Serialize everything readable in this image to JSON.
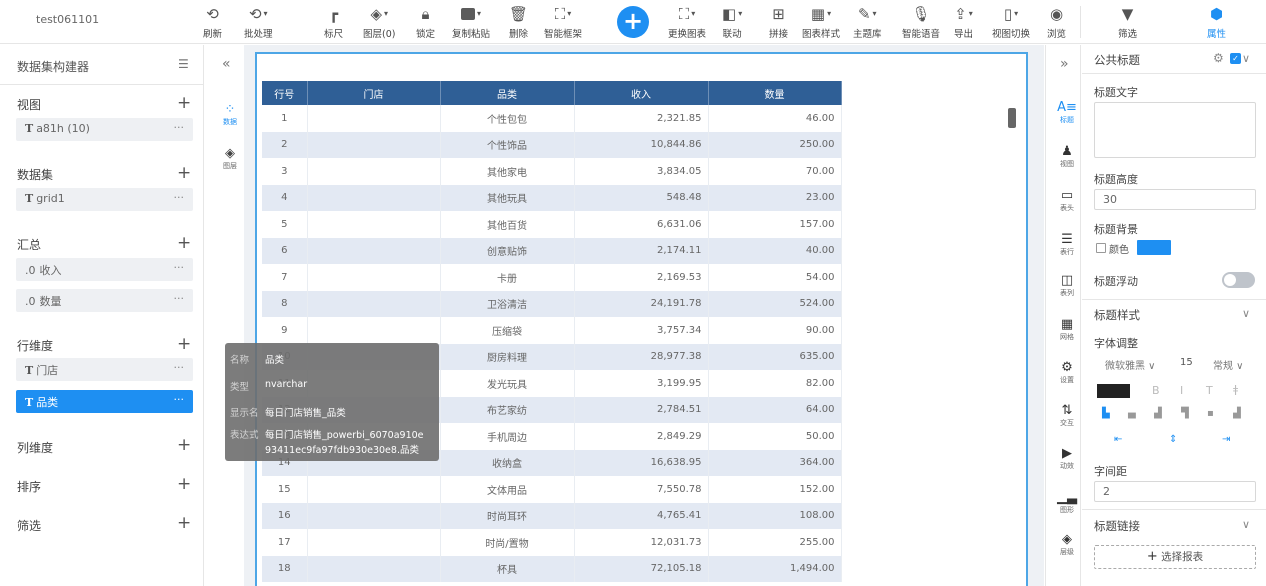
{
  "app": {
    "title": "test061101"
  },
  "toolbar": {
    "refresh": "刷新",
    "batch": "批处理",
    "ruler": "标尺",
    "layers": "图层(0)",
    "lock": "锁定",
    "copy_paste": "复制粘贴",
    "delete": "删除",
    "smart_frame": "智能框架",
    "add": "+",
    "replace_chart": "更换图表",
    "linkage": "联动",
    "stitch": "拼接",
    "chart_style": "图表样式",
    "theme_lib": "主题库",
    "smart_voice": "智能语音",
    "export": "导出",
    "view_switch": "视图切换",
    "browse": "浏览",
    "filter": "筛选",
    "properties": "属性"
  },
  "left_panel": {
    "header": "数据集构建器",
    "sections": {
      "view": {
        "title": "视图",
        "item": "a81h (10)"
      },
      "dataset": {
        "title": "数据集",
        "item": "grid1"
      },
      "summary": {
        "title": "汇总",
        "items": [
          "收入",
          "数量"
        ]
      },
      "row_dim": {
        "title": "行维度",
        "items": [
          "门店",
          "品类"
        ]
      },
      "col_dim": {
        "title": "列维度"
      },
      "sort": {
        "title": "排序"
      },
      "filter": {
        "title": "筛选"
      }
    },
    "type_t": "T",
    "type_num": ".0",
    "dots": "···"
  },
  "strip": {
    "data": "数据",
    "layer": "图层"
  },
  "table": {
    "headers": [
      "行号",
      "门店",
      "品类",
      "收入",
      "数量"
    ],
    "rows": [
      [
        "1",
        "",
        "个性包包",
        "2,321.85",
        "46.00"
      ],
      [
        "2",
        "",
        "个性饰品",
        "10,844.86",
        "250.00"
      ],
      [
        "3",
        "",
        "其他家电",
        "3,834.05",
        "70.00"
      ],
      [
        "4",
        "",
        "其他玩具",
        "548.48",
        "23.00"
      ],
      [
        "5",
        "",
        "其他百货",
        "6,631.06",
        "157.00"
      ],
      [
        "6",
        "",
        "创意贴饰",
        "2,174.11",
        "40.00"
      ],
      [
        "7",
        "",
        "卡册",
        "2,169.53",
        "54.00"
      ],
      [
        "8",
        "",
        "卫浴清洁",
        "24,191.78",
        "524.00"
      ],
      [
        "9",
        "",
        "压缩袋",
        "3,757.34",
        "90.00"
      ],
      [
        "10",
        "",
        "厨房料理",
        "28,977.38",
        "635.00"
      ],
      [
        "11",
        "",
        "发光玩具",
        "3,199.95",
        "82.00"
      ],
      [
        "12",
        "",
        "布艺家纺",
        "2,784.51",
        "64.00"
      ],
      [
        "13",
        "",
        "手机周边",
        "2,849.29",
        "50.00"
      ],
      [
        "14",
        "",
        "收纳盒",
        "16,638.95",
        "364.00"
      ],
      [
        "15",
        "",
        "文体用品",
        "7,550.78",
        "152.00"
      ],
      [
        "16",
        "",
        "时尚耳环",
        "4,765.41",
        "108.00"
      ],
      [
        "17",
        "",
        "时尚/置物",
        "12,031.73",
        "255.00"
      ],
      [
        "18",
        "",
        "杯具",
        "72,105.18",
        "1,494.00"
      ]
    ]
  },
  "tooltip": {
    "name_label": "名称",
    "name_value": "品类",
    "type_label": "类型",
    "type_value": "nvarchar",
    "alias_label": "显示名",
    "alias_value": "每日门店销售_品类",
    "expr_label": "表达式",
    "expr_value_1": "每日门店销售_powerbi_6070a910e",
    "expr_value_2": "93411ec9fa97fdb930e30e8.品类"
  },
  "right_strip": {
    "title": "标题",
    "view": "视图",
    "table_head": "表头",
    "table_row": "表行",
    "table_col": "表列",
    "grid_line": "网格",
    "settings": "设置",
    "interaction": "交互",
    "animation": "动效",
    "chart": "图形",
    "layer": "层级"
  },
  "props": {
    "header": "公共标题",
    "title_text_label": "标题文字",
    "title_text_value": "",
    "title_height_label": "标题高度",
    "title_height_value": "30",
    "title_bg_label": "标题背景",
    "color_label": "颜色",
    "color_value": "#1e8ff2",
    "title_float_label": "标题浮动",
    "title_style_label": "标题样式",
    "font_adjust_label": "字体调整",
    "font_family_value": "微软雅黑",
    "font_size_value": "15",
    "font_weight_value": "常规",
    "letter_spacing_label": "字间距",
    "letter_spacing_value": "2",
    "title_link_label": "标题链接",
    "select_report_label": "选择报表"
  }
}
